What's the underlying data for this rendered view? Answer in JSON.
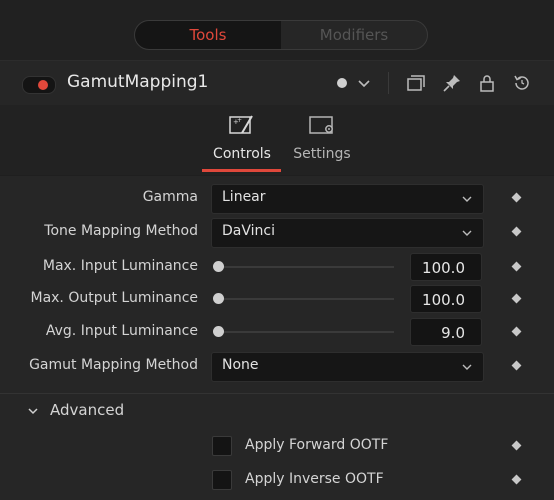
{
  "tabs": {
    "tools": "Tools",
    "modifiers": "Modifiers"
  },
  "node": {
    "title": "GamutMapping1"
  },
  "subtabs": {
    "controls": "Controls",
    "settings": "Settings"
  },
  "controls": {
    "gamma": {
      "label": "Gamma",
      "value": "Linear"
    },
    "tone_mapping": {
      "label": "Tone Mapping Method",
      "value": "DaVinci"
    },
    "max_input": {
      "label": "Max. Input Luminance",
      "value": "100.0"
    },
    "max_output": {
      "label": "Max. Output Luminance",
      "value": "100.0"
    },
    "avg_input": {
      "label": "Avg. Input Luminance",
      "value": "9.0"
    },
    "gamut_mapping": {
      "label": "Gamut Mapping Method",
      "value": "None"
    }
  },
  "advanced": {
    "label": "Advanced",
    "apply_forward": "Apply Forward OOTF",
    "apply_inverse": "Apply Inverse OOTF"
  },
  "colors": {
    "accent": "#e0483b",
    "background": "#262626"
  }
}
